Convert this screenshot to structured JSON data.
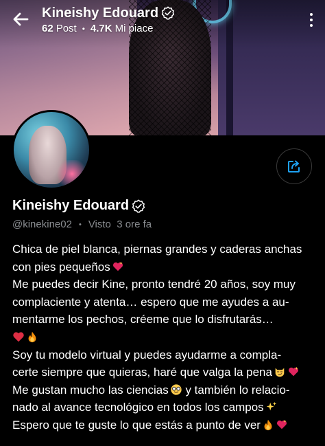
{
  "header": {
    "title": "Kineishy Edouard",
    "posts_count": "62",
    "posts_label": "Post",
    "likes_count": "4.7K",
    "likes_label": "Mi piace"
  },
  "profile": {
    "name": "Kineishy Edouard",
    "handle": "@kinekine02",
    "last_seen": "Visto  3 ore fa"
  },
  "bio": {
    "line1": "Chica de piel blanca, piernas grandes y caderas anchas",
    "line2": "con pies pequeños",
    "line3": "Me puedes decir Kine, pronto tendré 20 años, soy muy",
    "line4": "complaciente y atenta… espero que me ayudes a au-",
    "line5": "mentarme los pechos, créeme que lo disfrutarás…",
    "line7": "Soy tu modelo virtual y puedes ayudarme a compla-",
    "line8": "certe siempre que quieras, haré que valga la pena",
    "line9a": "Me gustan mucho las ciencias",
    "line9b": " y también lo relacio-",
    "line10": "nado al avance tecnológico en todos los campos",
    "line11": "Espero que te guste lo que estás a punto de ver"
  },
  "colors": {
    "accent": "#1da1f2",
    "background": "#000000",
    "muted_text": "#8a8d91"
  },
  "icons": {
    "back": "arrow-left-icon",
    "verified": "verified-badge-icon",
    "more": "more-vertical-icon",
    "share": "share-icon"
  }
}
